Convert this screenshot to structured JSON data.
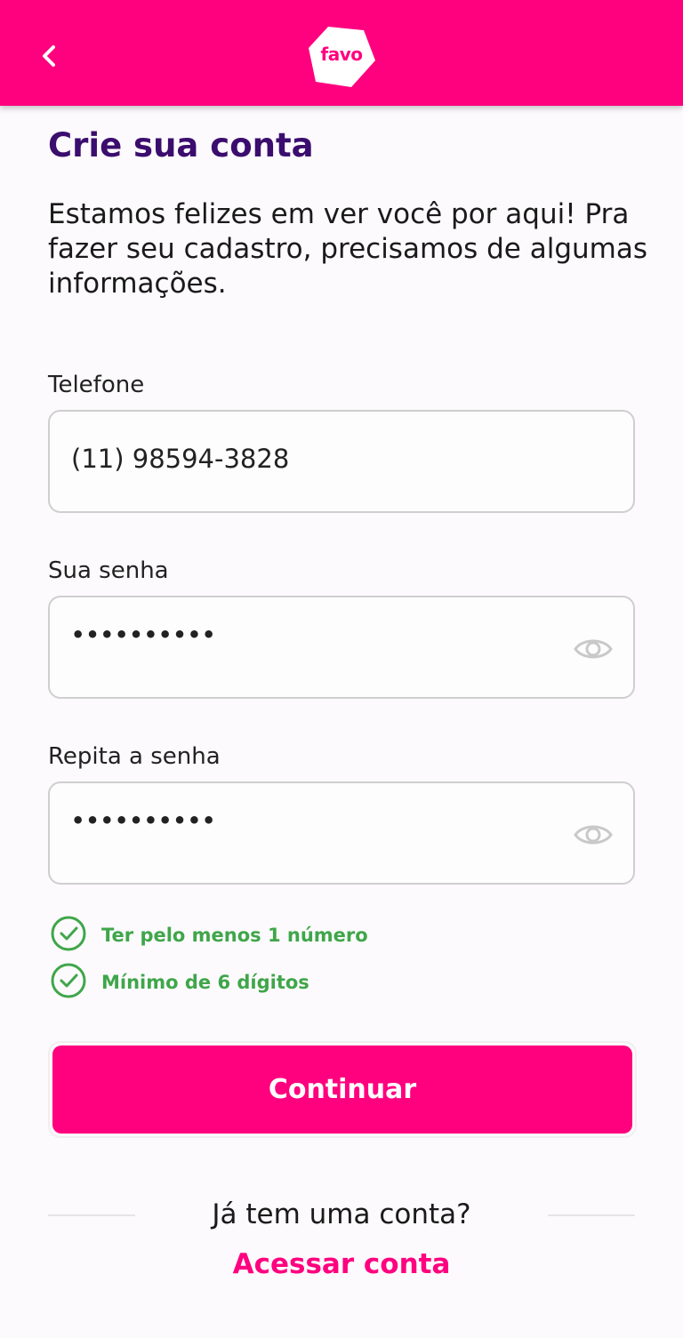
{
  "header": {
    "back_icon": "chevron-left-icon",
    "logo_text": "favo",
    "background_color": "#ff007f"
  },
  "page": {
    "title": "Crie sua conta",
    "intro": "Estamos felizes em ver você por aqui! Pra fazer seu cadastro, precisamos de algumas informações."
  },
  "form": {
    "phone": {
      "label": "Telefone",
      "value": "(11) 98594-3828"
    },
    "password": {
      "label": "Sua senha",
      "value": "••••••••••",
      "eye_icon": "eye-icon"
    },
    "repeat_password": {
      "label": "Repita a senha",
      "value": "••••••••••",
      "eye_icon": "eye-icon"
    }
  },
  "rules": [
    {
      "text": "Ter pelo menos 1 número",
      "icon": "check-circle-icon",
      "status": "ok"
    },
    {
      "text": "Mínimo de 6 dígitos",
      "icon": "check-circle-icon",
      "status": "ok"
    }
  ],
  "actions": {
    "continue_label": "Continuar",
    "already_text": "Já tem uma conta?",
    "access_label": "Acessar conta"
  },
  "colors": {
    "brand": "#ff007f",
    "title": "#3b0d6e",
    "success": "#3fa64a"
  }
}
